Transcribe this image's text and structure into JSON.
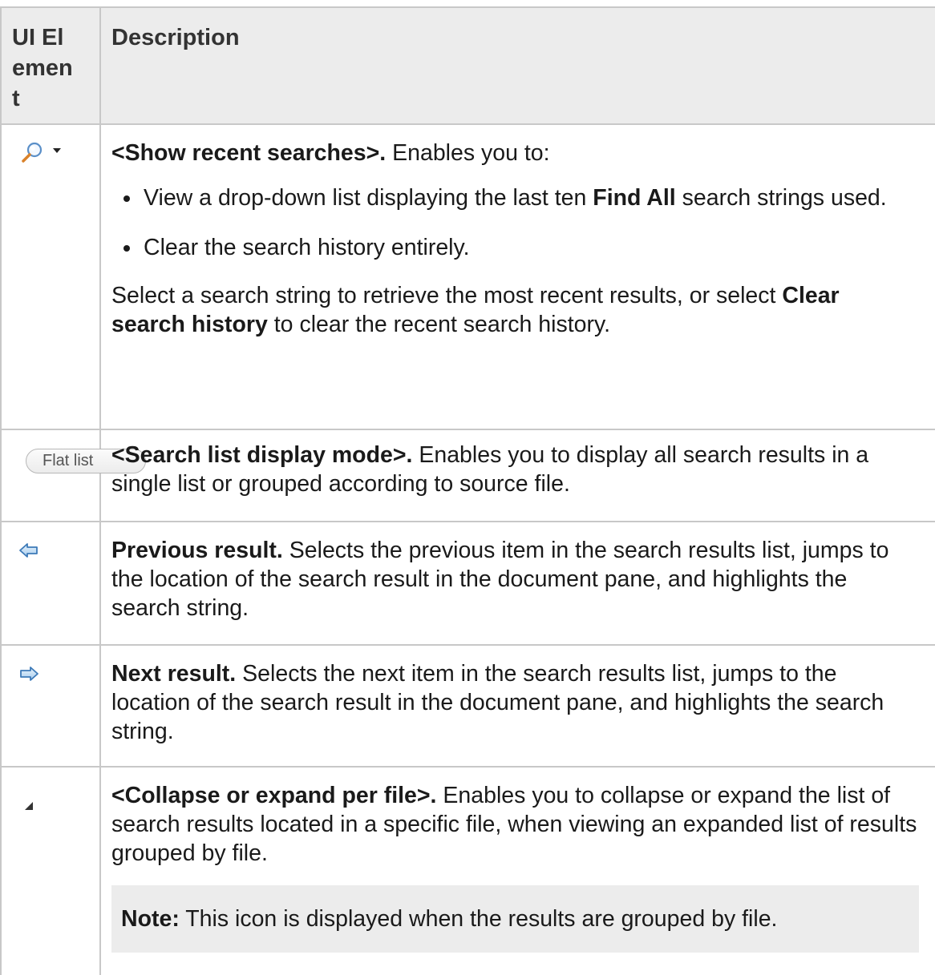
{
  "table": {
    "headers": {
      "col1": "UI Element",
      "col2": "Description"
    },
    "rows": {
      "recent": {
        "icon": "magnifier-dropdown-icon",
        "title": "<Show recent searches>.",
        "intro": "Enables you to:",
        "bullets": {
          "b1_pre": "View a drop-down list displaying the last ten ",
          "b1_bold": "Find All",
          "b1_post": " search strings used.",
          "b2": "Clear the search history entirely."
        },
        "after_pre": "Select a search string to retrieve the most recent results, or select ",
        "after_bold": "Clear search history",
        "after_post": " to clear the recent search history."
      },
      "display_mode": {
        "button_label": "Flat list",
        "title": "<Search list display mode>.",
        "text": " Enables you to display all search results in a single list or grouped according to source file."
      },
      "previous": {
        "icon": "previous-arrow-icon",
        "title": "Previous result.",
        "text": " Selects the previous item in the search results list, jumps to the location of the search result in the document pane, and highlights the search string."
      },
      "next": {
        "icon": "next-arrow-icon",
        "title": "Next result.",
        "text": " Selects the next item in the search results list, jumps to the location of the search result in the document pane, and highlights the search string."
      },
      "collapse": {
        "icon": "collapse-triangle-icon",
        "title": "<Collapse or expand per file>.",
        "text": " Enables you to collapse or expand the list of search results located in a specific file, when viewing an expanded list of results grouped by file.",
        "note_label": "Note:",
        "note_text": " This icon is displayed when the results are grouped by file."
      }
    }
  },
  "colors": {
    "header_bg": "#ececec",
    "border": "#c8c8c8",
    "note_bg": "#ececec",
    "arrow_blue": "#4a90c8"
  }
}
